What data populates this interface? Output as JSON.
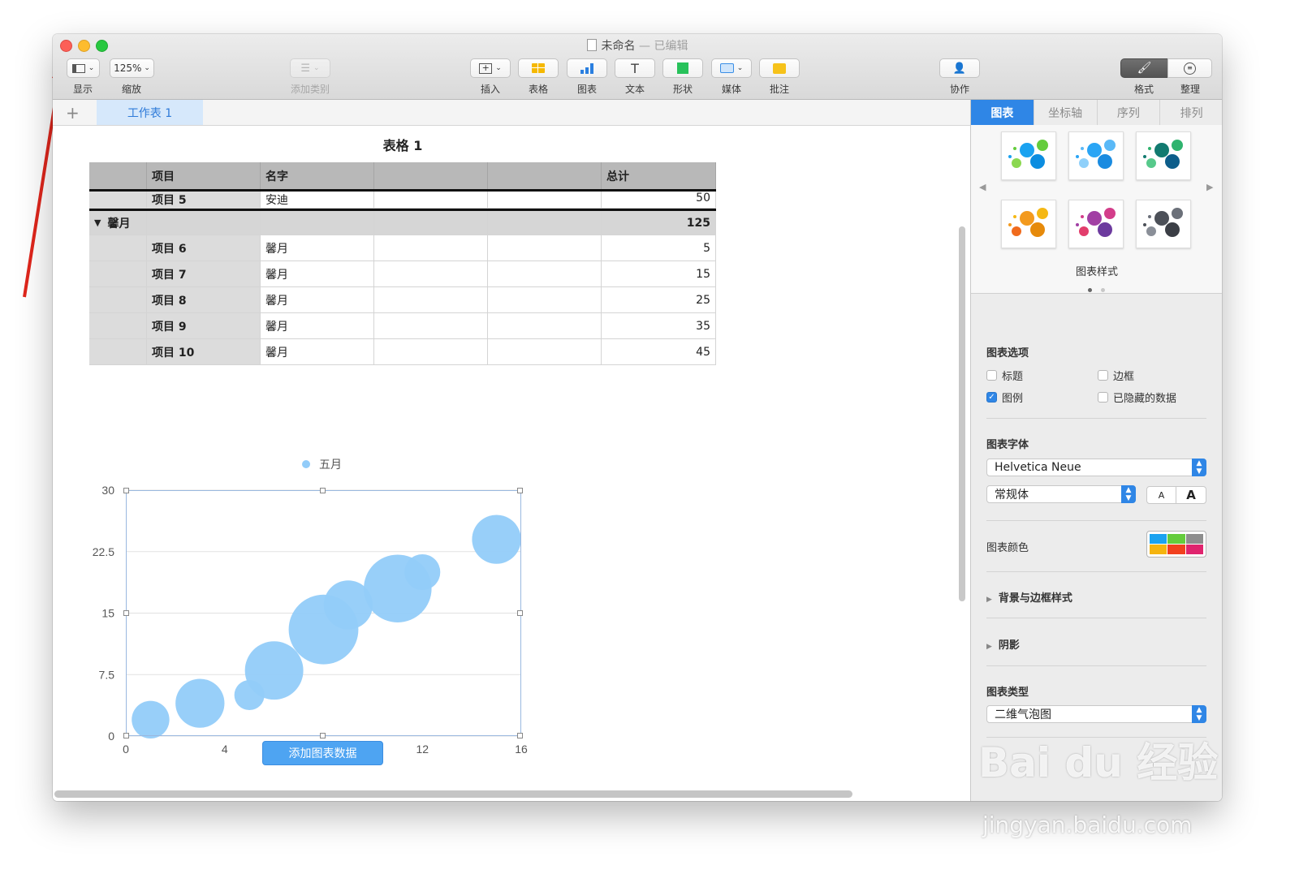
{
  "window": {
    "title_name": "未命名",
    "title_sep": " — ",
    "title_status": "已编辑"
  },
  "toolbar": {
    "view_label": "显示",
    "zoom_value": "125%",
    "zoom_label": "缩放",
    "add_category_label": "添加类别",
    "insert_label": "插入",
    "table_label": "表格",
    "chart_label": "图表",
    "text_label": "文本",
    "shape_label": "形状",
    "media_label": "媒体",
    "comment_label": "批注",
    "collaborate_label": "协作",
    "format_label": "格式",
    "organize_label": "整理"
  },
  "sheet_tabs": {
    "add": "+",
    "active": "工作表 1"
  },
  "table": {
    "title": "表格 1",
    "headers": [
      "",
      "项目",
      "名字",
      "",
      "",
      "总计"
    ],
    "top_row": {
      "item": "项目 5",
      "name": "安迪",
      "total": "50"
    },
    "group": {
      "label": "馨月",
      "total": "125"
    },
    "rows": [
      {
        "item": "项目 6",
        "name": "馨月",
        "total": "5"
      },
      {
        "item": "项目 7",
        "name": "馨月",
        "total": "15"
      },
      {
        "item": "项目 8",
        "name": "馨月",
        "total": "25"
      },
      {
        "item": "项目 9",
        "name": "馨月",
        "total": "35"
      },
      {
        "item": "项目 10",
        "name": "馨月",
        "total": "45"
      }
    ]
  },
  "chart_data": {
    "type": "scatter",
    "title": "",
    "xlabel": "",
    "ylabel": "",
    "legend": {
      "placement": "top-center",
      "entries": [
        "五月"
      ]
    },
    "xlim": [
      0,
      16
    ],
    "ylim": [
      0,
      30
    ],
    "x_ticks": [
      "0",
      "4",
      "8",
      "12",
      "16"
    ],
    "x_ticks_visible": [
      "0",
      "4",
      "12",
      "16"
    ],
    "y_ticks": [
      "0",
      "7.5",
      "15",
      "22.5",
      "30"
    ],
    "grid": true,
    "bubble_color": "#92ccf9",
    "series": [
      {
        "name": "五月",
        "points": [
          {
            "x": 1.0,
            "y": 2.0,
            "size": 2.0
          },
          {
            "x": 3.0,
            "y": 4.0,
            "size": 2.6
          },
          {
            "x": 5.0,
            "y": 5.0,
            "size": 1.6
          },
          {
            "x": 6.0,
            "y": 8.0,
            "size": 3.1
          },
          {
            "x": 8.0,
            "y": 13.0,
            "size": 3.7
          },
          {
            "x": 9.0,
            "y": 16.0,
            "size": 2.6
          },
          {
            "x": 11.0,
            "y": 18.0,
            "size": 3.6
          },
          {
            "x": 12.0,
            "y": 20.0,
            "size": 1.9
          },
          {
            "x": 15.0,
            "y": 24.0,
            "size": 2.6
          }
        ]
      }
    ]
  },
  "add_chart_data_button": "添加图表数据",
  "sidebar": {
    "tabs": [
      "图表",
      "坐标轴",
      "序列",
      "排列"
    ],
    "styles_caption": "图表样式",
    "options_title": "图表选项",
    "options": {
      "title": "标题",
      "border": "边框",
      "legend": "图例",
      "hidden_data": "已隐藏的数据"
    },
    "legend_checked": true,
    "font_title": "图表字体",
    "font_family": "Helvetica Neue",
    "font_style": "常规体",
    "font_small": "A",
    "font_large": "A",
    "color_title": "图表颜色",
    "palette": [
      "#1aa2f0",
      "#64cc3c",
      "#8e8e8e",
      "#f5b40f",
      "#f2401e",
      "#e0246e"
    ],
    "bg_border": "背景与边框样式",
    "shadow": "阴影",
    "type_title": "图表类型",
    "chart_type": "二维气泡图"
  },
  "style_swatches": [
    [
      "#1aa2f0",
      "#64cc3c",
      "#8bd850",
      "#0c8de0"
    ],
    [
      "#2aa5f5",
      "#5ab9f7",
      "#8fd0fa",
      "#1a8be0"
    ],
    [
      "#127a70",
      "#2fb36e",
      "#57c98b",
      "#0d5d8a"
    ],
    [
      "#f39a1e",
      "#f5b814",
      "#f06b1d",
      "#e68a0b"
    ],
    [
      "#a13fa4",
      "#d33d8a",
      "#e23d6c",
      "#6c3a9e"
    ],
    [
      "#4c5058",
      "#6b7079",
      "#8a8f98",
      "#3b3e45"
    ]
  ],
  "watermark": {
    "brand": "Bai du 经验",
    "url": "jingyan.baidu.com"
  }
}
